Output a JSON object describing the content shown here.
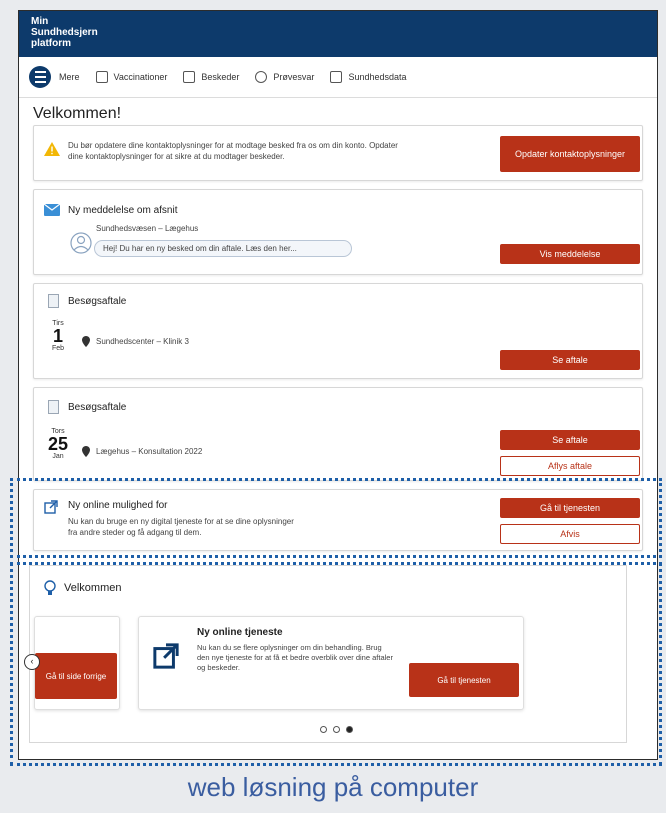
{
  "header": {
    "logo_lines": [
      "Min",
      "Sundhedsjern",
      "platform"
    ]
  },
  "nav": {
    "items": [
      "Mere",
      "Vaccinationer",
      "Beskeder",
      "Prøvesvar",
      "Sundhedsdata"
    ]
  },
  "welcome": "Velkommen!",
  "alert_card": {
    "text_line1": "Du bør opdatere dine kontaktoplysninger for at modtage besked fra os om din konto. Opdater",
    "text_line2": "dine kontaktoplysninger for at sikre at du modtager beskeder.",
    "button": "Opdater kontaktoplysninger"
  },
  "message_card": {
    "title": "Ny meddelelse om afsnit",
    "sender": "Sundhedsvæsen – Lægehus",
    "preview": "Hej! Du har en ny besked om din aftale. Læs den her...",
    "button": "Vis meddelelse"
  },
  "appointment1": {
    "title": "Besøgsaftale",
    "weekday": "Tirs",
    "day": "1",
    "month": "Feb",
    "location": "Sundhedscenter – Klinik 3",
    "button": "Se aftale"
  },
  "appointment2": {
    "title": "Besøgsaftale",
    "weekday": "Tors",
    "day": "25",
    "month": "Jan",
    "location": "Lægehus – Konsultation 2022",
    "button_primary": "Se aftale",
    "button_secondary": "Aflys aftale"
  },
  "external_card": {
    "title": "Ny online mulighed for",
    "text_line1": "Nu kan du bruge en ny digital tjeneste for at se dine oplysninger",
    "text_line2": "fra andre steder og få adgang til dem.",
    "button_primary": "Gå til tjenesten",
    "button_secondary": "Afvis"
  },
  "carousel": {
    "title": "Velkommen",
    "slide_prev_button": "Gå til side forrige",
    "slide_title": "Ny online tjeneste",
    "slide_text": "Nu kan du se flere oplysninger om din behandling. Brug den nye tjeneste for at få et bedre overblik over dine aftaler og beskeder.",
    "slide_button": "Gå til tjenesten",
    "dots": 3,
    "active_dot": 2
  },
  "caption": "web løsning på computer",
  "colors": {
    "header": "#0d3a6b",
    "accent": "#b83218",
    "outline": "#1e5fa8"
  }
}
